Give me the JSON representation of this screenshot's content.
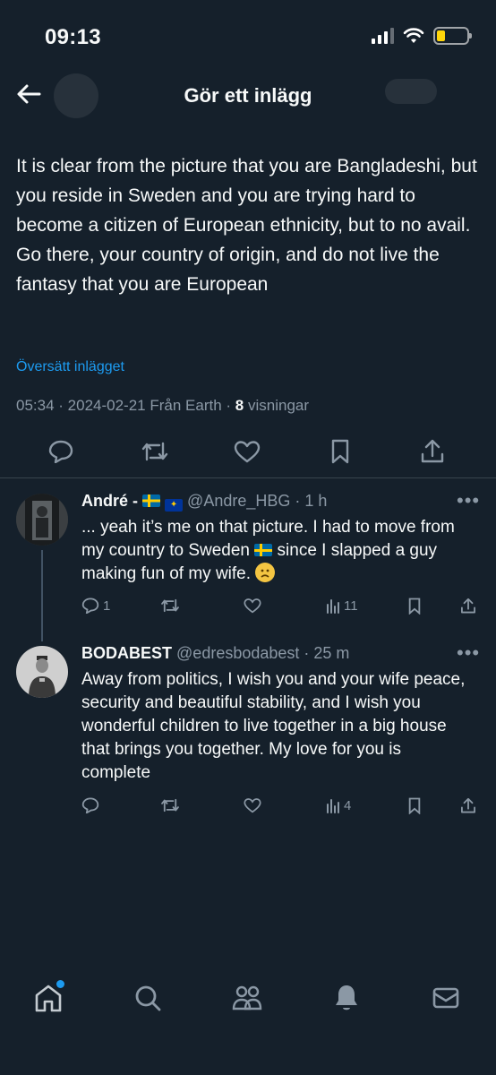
{
  "status_bar": {
    "time": "09:13"
  },
  "header": {
    "title": "Gör ett inlägg"
  },
  "post": {
    "text": "It is clear from the picture that you are Bangladeshi, but you reside in Sweden and you are trying hard to become a citizen of European ethnicity, but to no avail. Go there, your country of origin, and do not live the fantasy that you are European",
    "translate_label": "Översätt inlägget",
    "time": "05:34",
    "date": "2024-02-21",
    "source": "Från Earth",
    "views_count": "8",
    "views_label": "visningar"
  },
  "replies": [
    {
      "name": "André -",
      "handle": "@Andre_HBG",
      "age": "1 h",
      "text_a": "... yeah it’s me on that picture. I had to move from my country to Sweden",
      "text_b": "since I slapped a guy making fun of my wife.",
      "reply_count": "1",
      "views": "11"
    },
    {
      "name": "BODABEST",
      "handle": "@edresbodabest",
      "age": "25 m",
      "text": "Away from politics, I wish you and your wife peace, security and beautiful stability, and I wish you wonderful children to live together in a big house that brings you together. My love for you is complete",
      "views": "4"
    }
  ],
  "colors": {
    "background": "#15202b",
    "accent": "#1d9bf0",
    "muted": "#8b98a5",
    "text": "#f7f9f9"
  },
  "icons": [
    "back-arrow-icon",
    "comment-icon",
    "repost-icon",
    "like-icon",
    "bookmark-icon",
    "share-icon",
    "views-icon",
    "more-icon",
    "home-icon",
    "search-icon",
    "communities-icon",
    "notifications-icon",
    "messages-icon"
  ]
}
